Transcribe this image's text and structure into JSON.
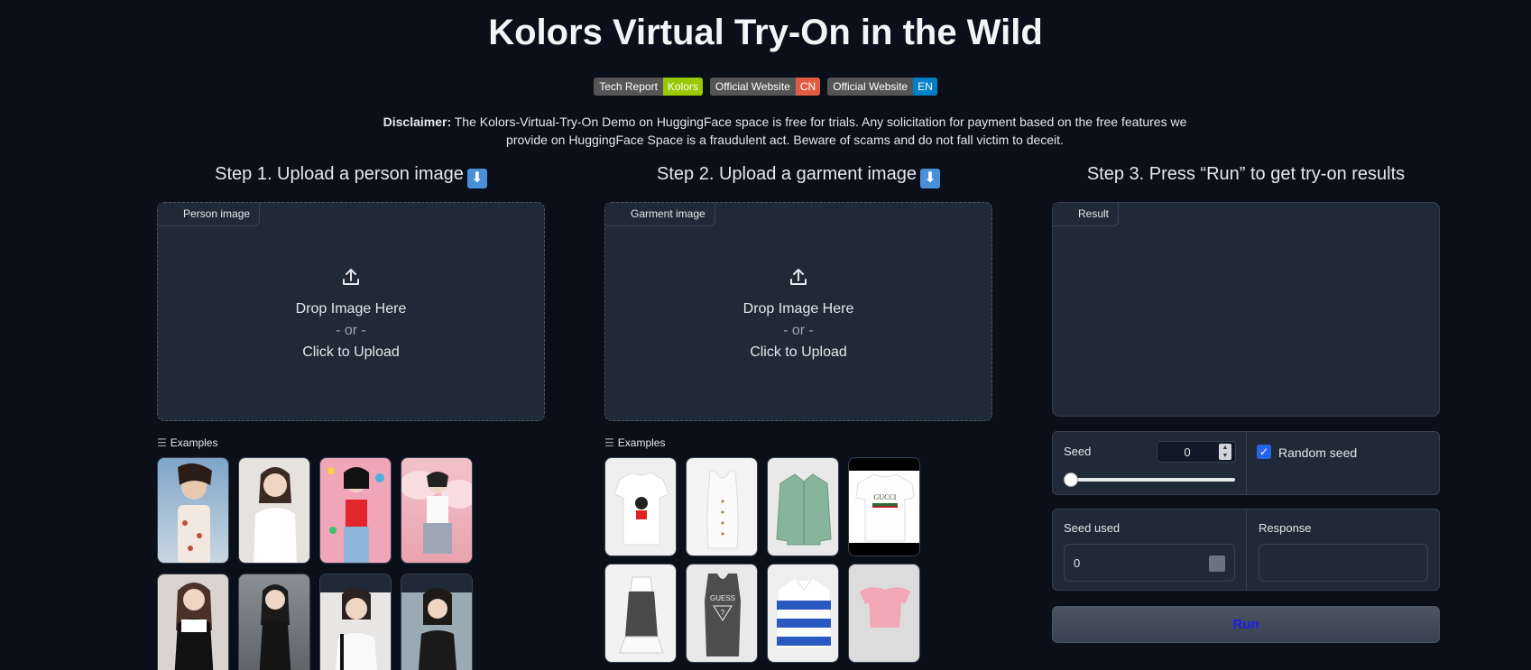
{
  "header": {
    "title": "Kolors Virtual Try-On in the Wild",
    "badges": [
      {
        "left": "Tech Report",
        "right": "Kolors",
        "color": "#97ca00"
      },
      {
        "left": "Official Website",
        "right": "CN",
        "color": "#e05d44"
      },
      {
        "left": "Official Website",
        "right": "EN",
        "color": "#007ec6"
      }
    ],
    "disclaimer_bold": "Disclaimer:",
    "disclaimer_text": " The Kolors-Virtual-Try-On Demo on HuggingFace space is free for trials. Any solicitation for payment based on the free features we provide on HuggingFace Space is a fraudulent act. Beware of scams and do not fall victim to deceit."
  },
  "steps": {
    "step1": "Step 1. Upload a person image",
    "step2": "Step 2. Upload a garment image",
    "step3": "Step 3. Press “Run” to get try-on results"
  },
  "person_panel": {
    "label": "Person image",
    "drop": "Drop Image Here",
    "or": "- or -",
    "click": "Click to Upload"
  },
  "garment_panel": {
    "label": "Garment image",
    "drop": "Drop Image Here",
    "or": "- or -",
    "click": "Click to Upload"
  },
  "result_panel": {
    "label": "Result"
  },
  "examples_label": "Examples",
  "controls": {
    "seed_label": "Seed",
    "seed_value": "0",
    "random_seed_label": "Random seed",
    "random_seed_checked": true,
    "seed_used_label": "Seed used",
    "seed_used_value": "0",
    "response_label": "Response",
    "run_label": "Run"
  },
  "colors": {
    "accent": "#2563eb",
    "run_text": "#1d1df0",
    "background": "#0b0f19",
    "panel": "#1f2937"
  }
}
